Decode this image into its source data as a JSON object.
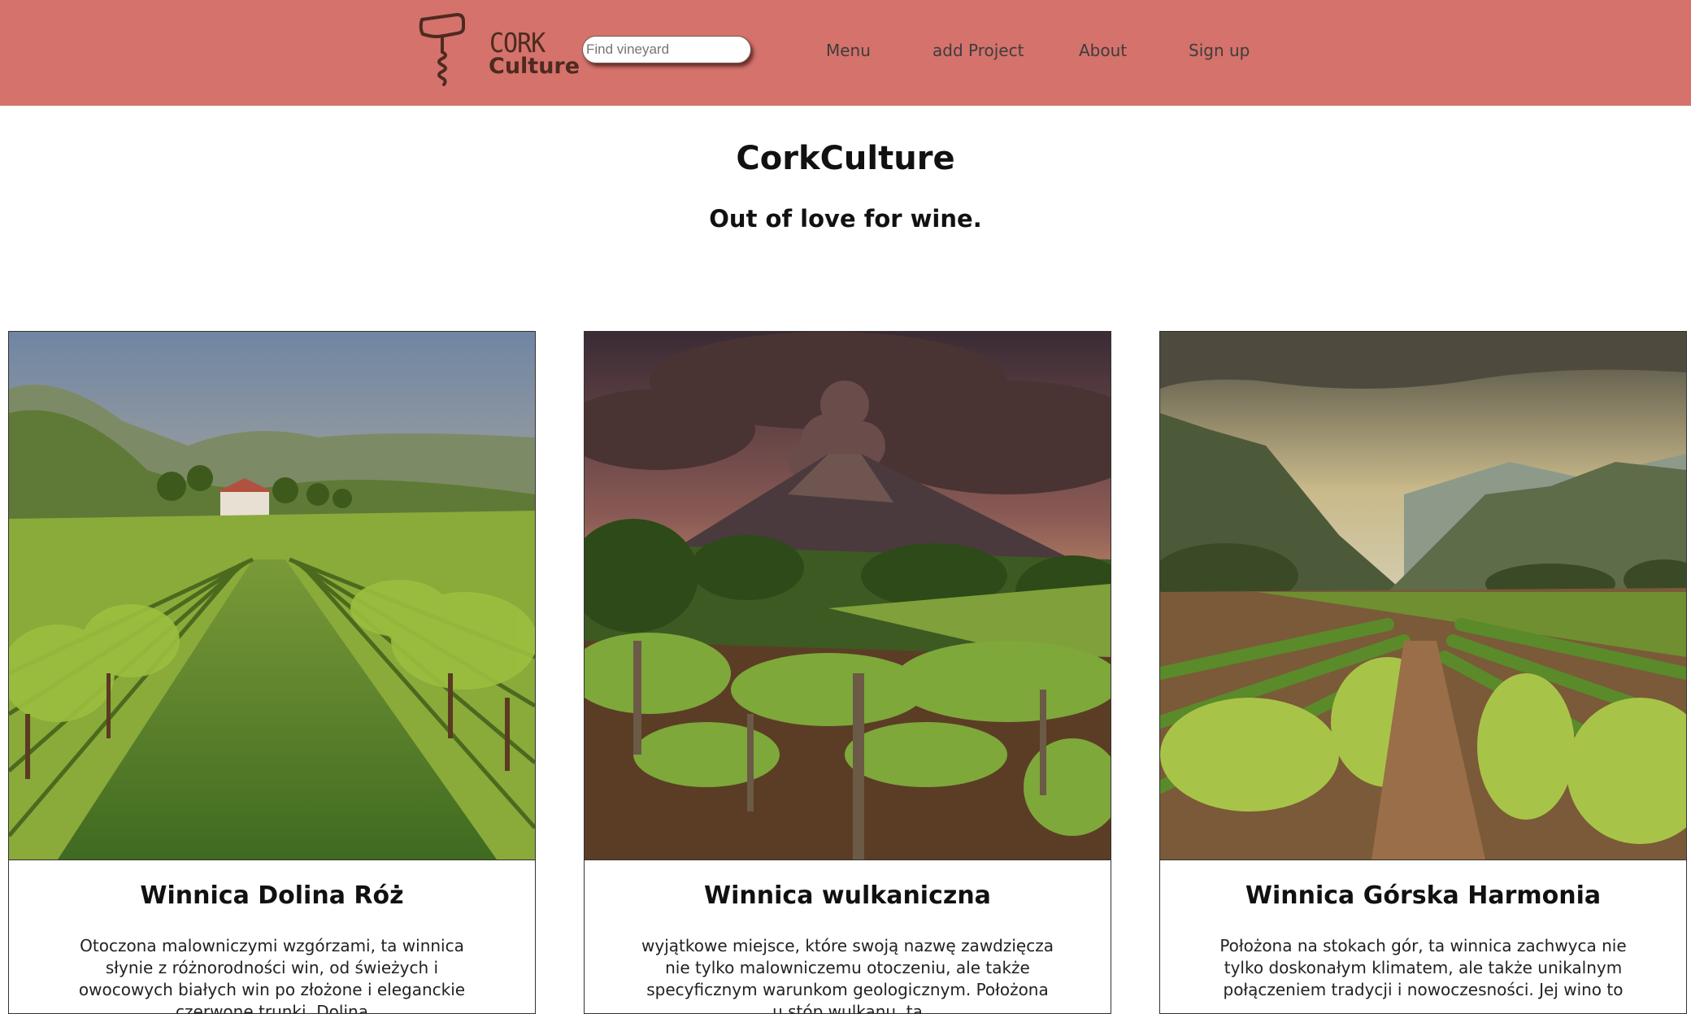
{
  "header": {
    "brand_top": "CORK",
    "brand_bottom": "Culture",
    "search_placeholder": "Find vineyard",
    "nav": [
      "Menu",
      "add Project",
      "About",
      "Sign up"
    ],
    "background_color": "#d4726b"
  },
  "hero": {
    "title": "CorkCulture",
    "subtitle": "Out of love for wine."
  },
  "cards": [
    {
      "title": "Winnica Dolina Róż",
      "description": "Otoczona malowniczymi wzgórzami, ta winnica słynie z różnorodności win, od świeżych i owocowych białych win po złożone i eleganckie czerwone trunki. Dolina",
      "image": "vineyard-valley-with-house"
    },
    {
      "title": "Winnica wulkaniczna",
      "description": "wyjątkowe miejsce, które swoją nazwę zawdzięcza nie tylko malowniczemu otoczeniu, ale także specyficznym warunkom geologicznym. Położona u stóp wulkanu, ta",
      "image": "vineyard-with-erupting-volcano"
    },
    {
      "title": "Winnica Górska Harmonia",
      "description": "Położona na stokach gór, ta winnica zachwyca nie tylko doskonałym klimatem, ale także unikalnym połączeniem tradycji i nowoczesności. Jej wino to",
      "image": "vineyard-in-mountain-valley"
    }
  ]
}
